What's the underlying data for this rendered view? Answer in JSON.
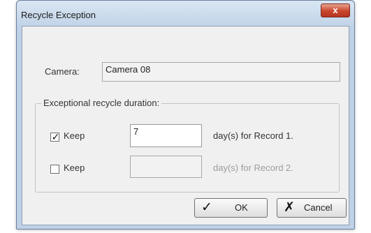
{
  "window": {
    "title": "Recycle Exception",
    "close_label": "x"
  },
  "camera": {
    "label": "Camera:",
    "value": "Camera 08"
  },
  "group": {
    "title": "Exceptional recycle duration:",
    "rows": [
      {
        "checked": true,
        "check_glyph": "✓",
        "keep_label": "Keep",
        "days_value": "7",
        "suffix": "day(s) for Record 1.",
        "enabled": true
      },
      {
        "checked": false,
        "check_glyph": "",
        "keep_label": "Keep",
        "days_value": "",
        "suffix": "day(s) for Record 2.",
        "enabled": false
      }
    ]
  },
  "buttons": {
    "ok_label": "OK",
    "ok_icon": "checkmark-icon",
    "ok_glyph": "✓",
    "cancel_label": "Cancel",
    "cancel_icon": "cross-icon",
    "cancel_glyph": "✗"
  },
  "colors": {
    "window_frame": "#bfd1e6",
    "close_button": "#c9452b",
    "dialog_background": "#f0f0f0"
  }
}
